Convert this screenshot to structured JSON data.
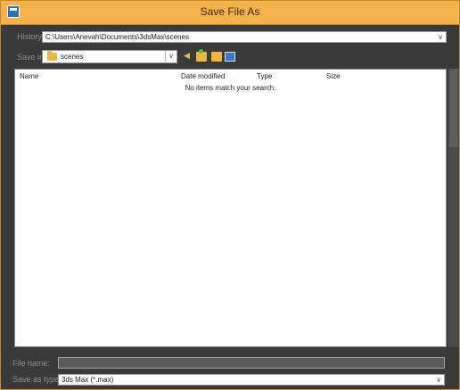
{
  "window": {
    "title": "Save File As"
  },
  "history": {
    "label": "History:",
    "value": "C:\\Users\\Anevah\\Documents\\3dsMax\\scenes"
  },
  "save_in": {
    "label": "Save in:",
    "value": "scenes"
  },
  "columns": [
    "Name",
    "Date modified",
    "Type",
    "Size"
  ],
  "list": {
    "empty_message": "No items match your search."
  },
  "file_name": {
    "label": "File name:",
    "value": ""
  },
  "save_as_type": {
    "label": "Save as type:",
    "value": "3ds Max (*.max)"
  },
  "colors": {
    "titlebar": "#f3b24a",
    "chrome": "#3a3a3a",
    "folder": "#e8b93d"
  },
  "icons": [
    "app-icon",
    "folder-icon",
    "back-icon",
    "up-folder-icon",
    "new-folder-icon",
    "view-menu-icon",
    "chevron-down-icon"
  ]
}
